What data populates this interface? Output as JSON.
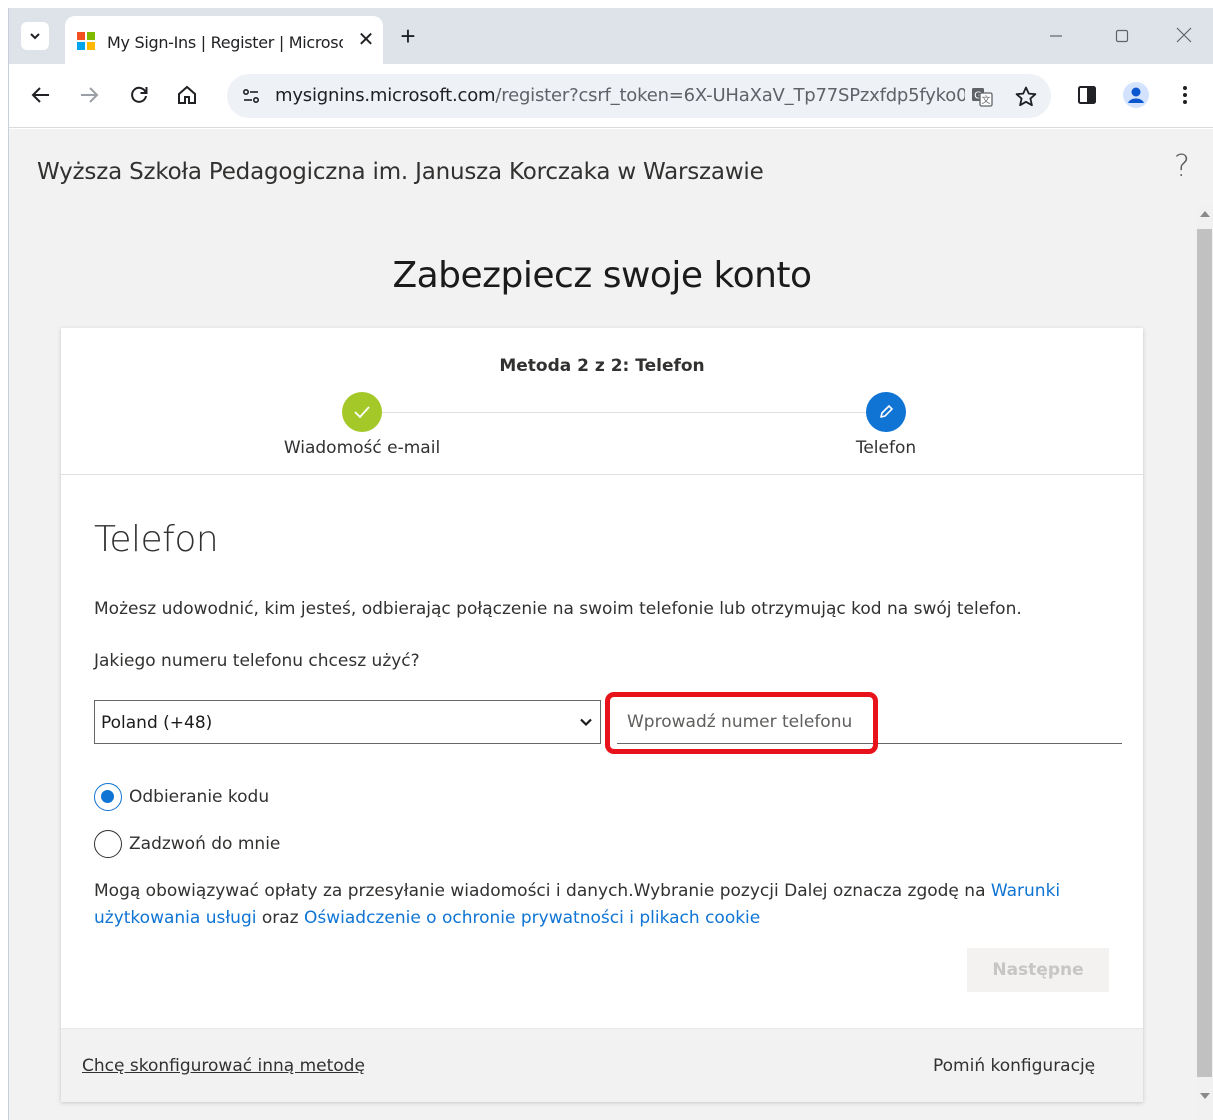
{
  "browser": {
    "tab_title": "My Sign-Ins | Register | Microsoft",
    "close_glyph": "✕",
    "new_tab_glyph": "+",
    "url_host": "mysignins.microsoft.com",
    "url_rest": "/register?csrf_token=6X-UHaXaV_Tp77SPzxfdp5fyko0...",
    "icons": [
      "chevron-down-icon",
      "microsoft-logo-icon",
      "close-icon",
      "plus-icon",
      "minimize-icon",
      "maximize-icon",
      "close-window-icon",
      "back-icon",
      "forward-icon",
      "reload-icon",
      "home-icon",
      "site-settings-icon",
      "translate-icon",
      "star-icon",
      "side-panel-icon",
      "profile-icon",
      "more-icon"
    ]
  },
  "org": {
    "name": "Wyższa Szkoła Pedagogiczna im. Janusza Korczaka w Warszawie",
    "help": "?"
  },
  "page": {
    "heading": "Zabezpiecz swoje konto",
    "step_title": "Metoda 2 z 2: Telefon",
    "steps": [
      {
        "label": "Wiadomość e-mail",
        "state": "done"
      },
      {
        "label": "Telefon",
        "state": "current"
      }
    ],
    "section_title": "Telefon",
    "description": "Możesz udowodnić, kim jesteś, odbierając połączenie na swoim telefonie lub otrzymując kod na swój telefon.",
    "question": "Jakiego numeru telefonu chcesz użyć?",
    "country": "Poland (+48)",
    "phone_placeholder": "Wprowadź numer telefonu",
    "options": [
      {
        "label": "Odbieranie kodu",
        "checked": true
      },
      {
        "label": "Zadzwoń do mnie",
        "checked": false
      }
    ],
    "legal_text": "Mogą obowiązywać opłaty za przesyłanie wiadomości i danych.Wybranie pozycji Dalej oznacza zgodę na ",
    "legal_link1": "Warunki użytkowania usługi",
    "legal_mid": " oraz ",
    "legal_link2": "Oświadczenie o ochronie prywatności i plikach cookie",
    "next_button": "Następne",
    "other_method_link": "Chcę skonfigurować inną metodę",
    "skip_link": "Pomiń konfigurację"
  },
  "colors": {
    "accent": "#0f74d4",
    "done_green": "#a4c828",
    "highlight_red": "#e8121b"
  }
}
